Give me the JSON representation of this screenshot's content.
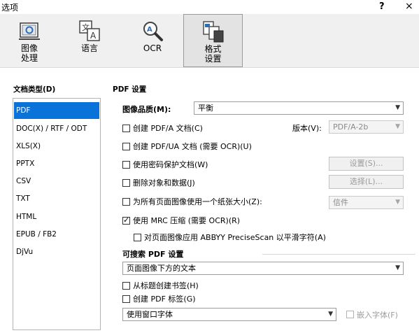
{
  "window": {
    "title": "选项",
    "help": "?",
    "close": "×"
  },
  "toolbar": {
    "buttons": [
      {
        "label": "图像\n处理",
        "icon": "image-processing-icon"
      },
      {
        "label": "语言",
        "icon": "language-icon"
      },
      {
        "label": "OCR",
        "icon": "ocr-magnifier-icon"
      },
      {
        "label": "格式\n设置",
        "icon": "format-settings-icon",
        "selected": true
      }
    ]
  },
  "left": {
    "title": "文档类型(D)",
    "items": [
      "PDF",
      "DOC(X) / RTF / ODT",
      "XLS(X)",
      "PPTX",
      "CSV",
      "TXT",
      "HTML",
      "EPUB / FB2",
      "DjVu"
    ],
    "selected_index": 0
  },
  "right": {
    "title": "PDF 设置",
    "image_quality_label": "图像品质(M):",
    "image_quality_value": "平衡",
    "create_pdfa": "创建 PDF/A 文档(C)",
    "version_label": "版本(V):",
    "version_value": "PDF/A-2b",
    "create_pdfua": "创建 PDF/UA 文档 (需要 OCR)(U)",
    "password_protect": "使用密码保护文档(W)",
    "settings_button": "设置(S)...",
    "delete_objects": "删除对象和数据(J)",
    "select_button": "选择(L)...",
    "single_paper_size": "为所有页面图像使用一个纸张大小(Z):",
    "paper_size_value": "信件",
    "use_mrc": "使用 MRC 压缩 (需要 OCR)(R)",
    "precisescan": "对页面图像应用 ABBYY PreciseScan 以平滑字符(A)",
    "searchable_title": "可搜索 PDF 设置",
    "searchable_mode": "页面图像下方的文本",
    "create_bookmarks": "从标题创建书签(H)",
    "create_tags": "创建 PDF 标签(G)",
    "font_mode": "使用窗口字体",
    "embed_fonts": "嵌入字体(F)"
  },
  "colors": {
    "selection": "#0a73d9",
    "toolbar_bg": "#f0f0f0"
  }
}
